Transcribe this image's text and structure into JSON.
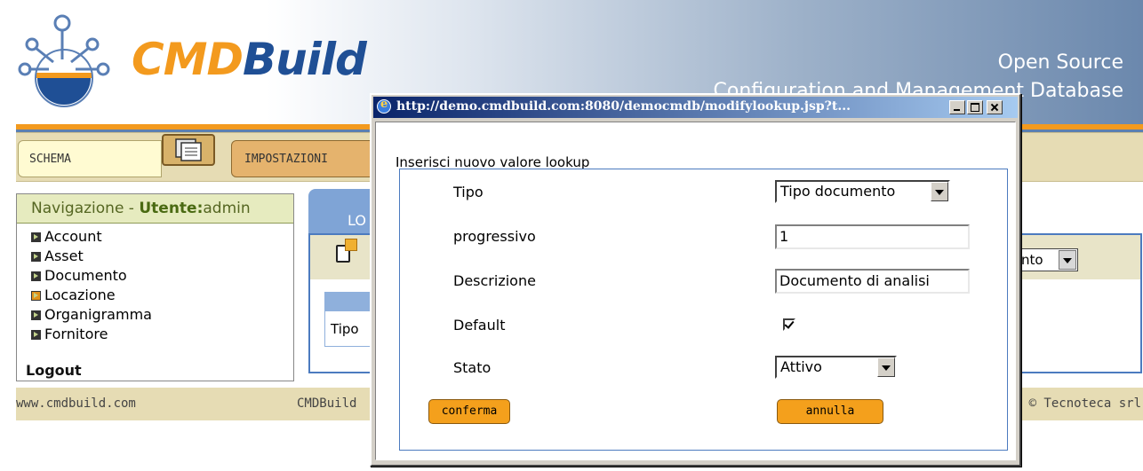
{
  "header": {
    "logo_cmd": "CMD",
    "logo_build": "Build",
    "tagline_line1": "Open Source",
    "tagline_line2": "Configuration and Management Database"
  },
  "menu": {
    "tabs": [
      {
        "label": "SCHEMA"
      },
      {
        "label": "IMPOSTAZIONI"
      }
    ]
  },
  "sidebar": {
    "title_prefix": "Navigazione - ",
    "user_label": "Utente:",
    "user_name": "admin",
    "items": [
      {
        "label": "Account"
      },
      {
        "label": "Asset"
      },
      {
        "label": "Documento"
      },
      {
        "label": "Locazione"
      },
      {
        "label": "Organigramma"
      },
      {
        "label": "Fornitore"
      }
    ],
    "logout": "Logout"
  },
  "main": {
    "tab_label": "LO",
    "cell_label": "Tipo",
    "right_select_value": "nto"
  },
  "footer": {
    "left": "www.cmdbuild.com",
    "center": "CMDBuild",
    "right": "© Tecnoteca srl"
  },
  "popup": {
    "title": "http://demo.cmdbuild.com:8080/democmdb/modifylookup.jsp?t...",
    "form_title": "Inserisci nuovo valore lookup",
    "fields": {
      "tipo_label": "Tipo",
      "tipo_value": "Tipo documento",
      "progressivo_label": "progressivo",
      "progressivo_value": "1",
      "descrizione_label": "Descrizione",
      "descrizione_value": "Documento di analisi",
      "default_label": "Default",
      "default_checked": true,
      "stato_label": "Stato",
      "stato_value": "Attivo"
    },
    "buttons": {
      "confirm": "conferma",
      "cancel": "annulla"
    }
  }
}
